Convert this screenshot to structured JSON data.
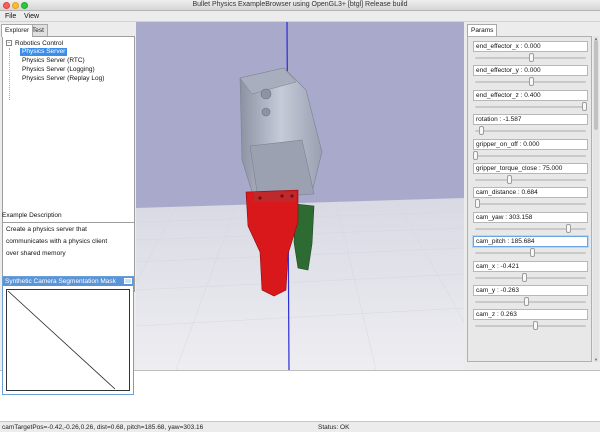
{
  "window": {
    "title": "Bullet Physics ExampleBrowser using OpenGL3+ [btgl] Release build"
  },
  "menu": {
    "file": "File",
    "view": "View"
  },
  "left_panel": {
    "tabs": [
      "Explorer",
      "Test"
    ],
    "tree_root": "Robotics Control",
    "tree_toggle": "−",
    "tree_items": [
      "Physics Server",
      "Physics Server (RTC)",
      "Physics Server (Logging)",
      "Physics Server (Replay Log)"
    ],
    "selected_item": "Physics Server",
    "description_label": "Example Description",
    "description_lines": [
      "Create a physics server that",
      "communicates with a physics client",
      "over shared memory"
    ]
  },
  "segmentation_window": {
    "title": "Synthetic Camera Segmentation Mask"
  },
  "viewport": {
    "colors": {
      "sky": "#a9aacb",
      "floor": "#e7e7ed",
      "axis": "#2b2bd8",
      "gripper_red": "#d9181c",
      "finger_green": "#2e6b32",
      "body_grey": "#b9bfd0"
    }
  },
  "params": {
    "tab": "Params",
    "items": [
      {
        "label": "end_effector_x : 0.000",
        "level": 0.5
      },
      {
        "label": "end_effector_y : 0.000",
        "level": 0.5
      },
      {
        "label": "end_effector_z : 0.400",
        "level": 0.98
      },
      {
        "label": "rotation : -1.587",
        "level": 0.05
      },
      {
        "label": "gripper_on_off : 0.000",
        "level": 0.0
      },
      {
        "label": "gripper_torque_close : 75.000",
        "level": 0.31
      },
      {
        "label": "cam_distance : 0.684",
        "level": 0.02
      },
      {
        "label": "cam_yaw : 303.158",
        "level": 0.84
      },
      {
        "label": "cam_pitch : 185.684",
        "level": 0.51
      },
      {
        "label": "cam_x : -0.421",
        "level": 0.44
      },
      {
        "label": "cam_y : -0.263",
        "level": 0.46
      },
      {
        "label": "cam_z : 0.263",
        "level": 0.54
      }
    ],
    "focused_index": 8
  },
  "status": {
    "left": "camTargetPos=-0.42,-0.26,0.26, dist=0.68, pitch=185.68, yaw=303.16",
    "right": "Status: OK"
  }
}
